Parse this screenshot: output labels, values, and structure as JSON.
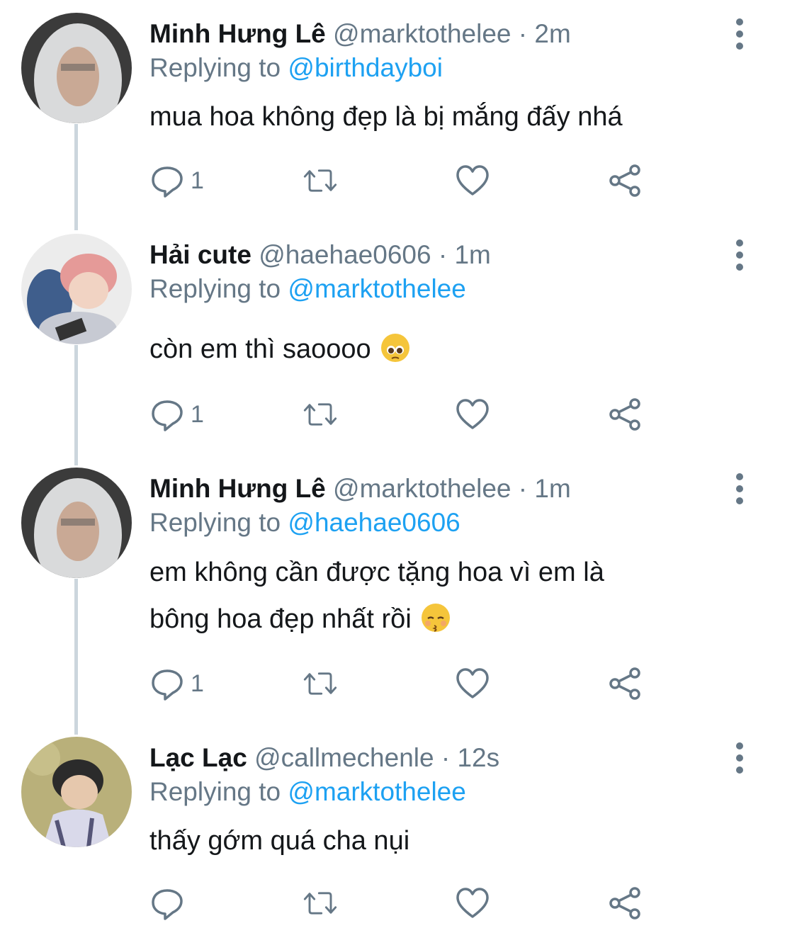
{
  "replies": [
    {
      "name": "Minh Hưng Lê",
      "handle": "@marktothelee",
      "dot": "·",
      "time": "2m",
      "replying_prefix": "Replying to",
      "replying_to": "@birthdayboi",
      "lines": [
        "mua hoa không đẹp là bị mắng đấy nhá"
      ],
      "reply_count": "1"
    },
    {
      "name": "Hải cute",
      "handle": "@haehae0606",
      "dot": "·",
      "time": "1m",
      "replying_prefix": "Replying to",
      "replying_to": "@marktothelee",
      "lines": [
        "còn em thì saoooo"
      ],
      "emoji": "pleading-face-emoji",
      "reply_count": "1"
    },
    {
      "name": "Minh Hưng Lê",
      "handle": "@marktothelee",
      "dot": "·",
      "time": "1m",
      "replying_prefix": "Replying to",
      "replying_to": "@haehae0606",
      "lines": [
        "em không cần được tặng hoa vì em là",
        "bông hoa đẹp nhất rồi"
      ],
      "emoji": "kissing-face-emoji",
      "reply_count": "1"
    },
    {
      "name": "Lạc Lạc",
      "handle": "@callmechenle",
      "dot": "·",
      "time": "12s",
      "replying_prefix": "Replying to",
      "replying_to": "@marktothelee",
      "lines": [
        "thấy gớm quá cha nụi"
      ],
      "reply_count": ""
    }
  ],
  "colors": {
    "accent": "#1da1f2",
    "muted": "#657786",
    "text": "#14171a",
    "thread": "#ccd6dd"
  },
  "icons": [
    "reply-icon",
    "retweet-icon",
    "like-icon",
    "share-icon",
    "more-options-icon"
  ]
}
